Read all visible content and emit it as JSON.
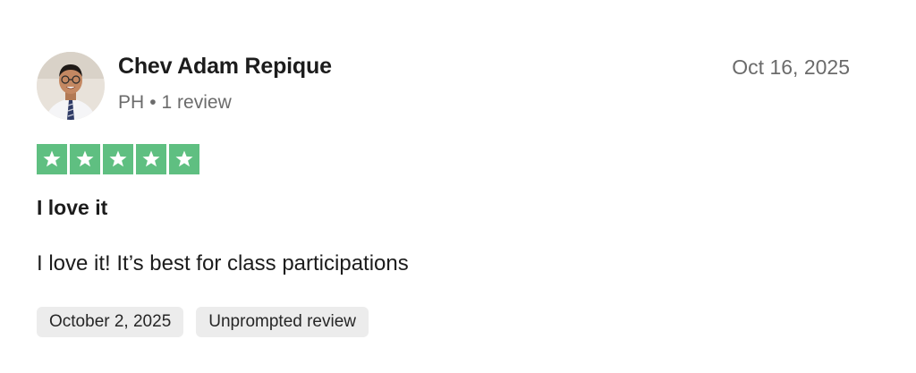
{
  "reviewer": {
    "name": "Chev Adam Repique",
    "country": "PH",
    "separator": "•",
    "review_count": "1 review"
  },
  "review": {
    "date": "Oct 16, 2025",
    "rating": 5,
    "rating_max": 5,
    "title": "I love it",
    "body": "I love it! It’s best for class participations"
  },
  "tags": {
    "experience_date": "October 2, 2025",
    "review_type": "Unprompted review"
  },
  "colors": {
    "star_background": "#5fbf81",
    "tag_background": "#ececec",
    "meta_text": "#6b6b6b"
  },
  "icons": {
    "star": "star-icon",
    "avatar": "avatar"
  }
}
